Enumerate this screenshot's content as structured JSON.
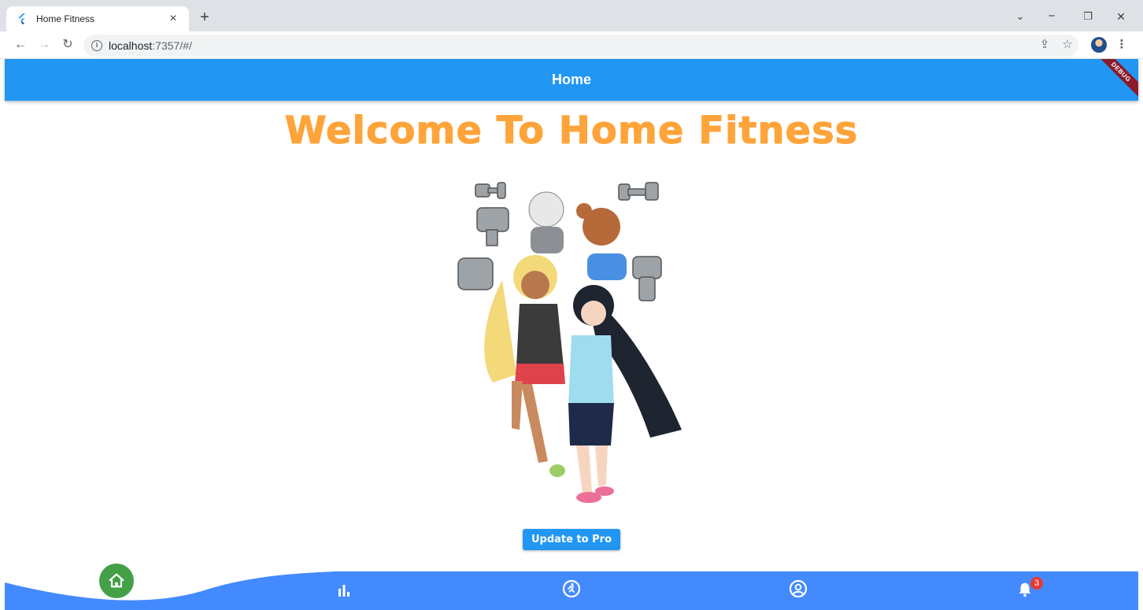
{
  "browser": {
    "tab_title": "Home Fitness",
    "tab_close": "×",
    "new_tab": "+",
    "url_host": "localhost",
    "url_path": ":7357/#/",
    "window_controls": {
      "minimize": "−",
      "restore": "❐",
      "close": "✕",
      "tab_search": "⌄"
    }
  },
  "app": {
    "title": "Home",
    "debug_banner": "DEBUG",
    "welcome_text": "Welcome To Home Fitness",
    "pro_button_label": "Update to Pro",
    "bottom_nav": {
      "items": [
        "home",
        "stats",
        "workout",
        "profile",
        "notifications"
      ],
      "notification_count": "3",
      "colors": {
        "nav_bg": "#448aff",
        "active_bubble": "#43a047"
      }
    },
    "colors": {
      "app_bar": "#2196f3",
      "welcome": "#ffa43a",
      "button": "#2196f3"
    }
  }
}
